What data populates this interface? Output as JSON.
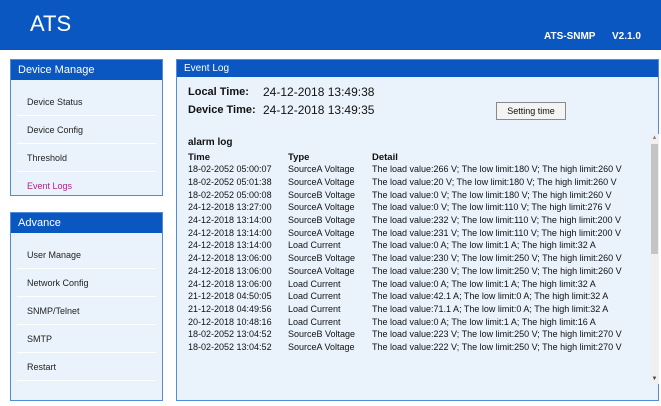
{
  "header": {
    "brand": "ATS",
    "model": "ATS-SNMP",
    "version": "V2.1.0"
  },
  "sidebar": {
    "device_manage": {
      "title": "Device Manage",
      "items": [
        {
          "label": "Device Status"
        },
        {
          "label": "Device Config"
        },
        {
          "label": "Threshold"
        },
        {
          "label": "Event Logs"
        }
      ]
    },
    "advance": {
      "title": "Advance",
      "items": [
        {
          "label": "User Manage"
        },
        {
          "label": "Network Config"
        },
        {
          "label": "SNMP/Telnet"
        },
        {
          "label": "SMTP"
        },
        {
          "label": "Restart"
        }
      ]
    }
  },
  "main": {
    "title": "Event Log",
    "local_time_label": "Local Time:",
    "local_time": "24-12-2018 13:49:38",
    "device_time_label": "Device Time:",
    "device_time": "24-12-2018 13:49:35",
    "setting_button": "Setting time",
    "log_title": "alarm log",
    "columns": [
      "Time",
      "Type",
      "Detail"
    ],
    "rows": [
      [
        "18-02-2052 05:00:07",
        "SourceA Voltage",
        "The load value:266 V; The low limit:180 V; The high limit:260 V"
      ],
      [
        "18-02-2052 05:01:38",
        "SourceA Voltage",
        "The load value:20 V; The low limit:180 V; The high limit:260 V"
      ],
      [
        "18-02-2052 05:00:08",
        "SourceB Voltage",
        "The load value:0 V; The low limit:180 V; The high limit:260 V"
      ],
      [
        "24-12-2018 13:27:00",
        "SourceA Voltage",
        "The load value:0 V; The low limit:110 V; The high limit:276 V"
      ],
      [
        "24-12-2018 13:14:00",
        "SourceB Voltage",
        "The load value:232 V; The low limit:110 V; The high limit:200 V"
      ],
      [
        "24-12-2018 13:14:00",
        "SourceA Voltage",
        "The load value:231 V; The low limit:110 V; The high limit:200 V"
      ],
      [
        "24-12-2018 13:14:00",
        "Load Current",
        "The load value:0 A; The low limit:1 A; The high limit:32 A"
      ],
      [
        "24-12-2018 13:06:00",
        "SourceB Voltage",
        "The load value:230 V; The low limit:250 V; The high limit:260 V"
      ],
      [
        "24-12-2018 13:06:00",
        "SourceA Voltage",
        "The load value:230 V; The low limit:250 V; The high limit:260 V"
      ],
      [
        "24-12-2018 13:06:00",
        "Load Current",
        "The load value:0 A; The low limit:1 A; The high limit:32 A"
      ],
      [
        "21-12-2018 04:50:05",
        "Load Current",
        "The load value:42.1 A; The low limit:0 A; The high limit:32 A"
      ],
      [
        "21-12-2018 04:49:56",
        "Load Current",
        "The load value:71.1 A; The low limit:0 A; The high limit:32 A"
      ],
      [
        "20-12-2018 10:48:16",
        "Load Current",
        "The load value:0 A; The low limit:1 A; The high limit:16 A"
      ],
      [
        "18-02-2052 13:04:52",
        "SourceB Voltage",
        "The load value:223 V; The low limit:250 V; The high limit:270 V"
      ],
      [
        "18-02-2052 13:04:52",
        "SourceA Voltage",
        "The load value:222 V; The low limit:250 V; The high limit:270 V"
      ]
    ]
  },
  "colors": {
    "header_bg": "#0a57c2",
    "panel_bg": "#eaf3fc",
    "active_item": "#b1218c"
  },
  "icons": {
    "scroll_up": "scroll-up-arrow-icon",
    "scroll_down": "scroll-down-arrow-icon"
  }
}
